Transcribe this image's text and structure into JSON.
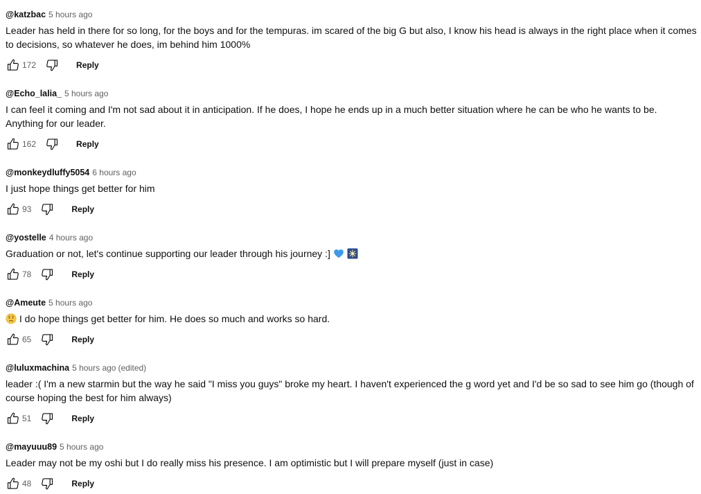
{
  "comments": [
    {
      "author": "@katzbac",
      "time": "5 hours ago",
      "text": "Leader has held in there for so long, for the boys and for the tempuras. im scared of the big G but also, I know his head is always in the right place when it comes to decisions, so whatever he does, im behind him 1000%",
      "likes": "172",
      "reply_label": "Reply"
    },
    {
      "author": "@Echo_lalia_",
      "time": "5 hours ago",
      "text": "I can feel it coming and I'm not sad about it in anticipation. If he does, I hope he ends up in a much better situation where he can be who he wants to be. Anything for our leader.",
      "likes": "162",
      "reply_label": "Reply"
    },
    {
      "author": "@monkeydluffy5054",
      "time": "6 hours ago",
      "text": "I just hope things get better for him",
      "likes": "93",
      "reply_label": "Reply"
    },
    {
      "author": "@yostelle",
      "time": "4 hours ago",
      "text": "Graduation or not, let's continue supporting our leader through his journey :]",
      "trailing_emojis": [
        "blue-heart-emoji",
        "sparkler-emoji"
      ],
      "likes": "78",
      "reply_label": "Reply"
    },
    {
      "author": "@Ameute",
      "time": "5 hours ago",
      "leading_emoji": "worried-face-emoji",
      "text": "I do hope things get better for him. He does so much and works so hard.",
      "likes": "65",
      "reply_label": "Reply"
    },
    {
      "author": "@luluxmachina",
      "time": "5 hours ago",
      "edited": "(edited)",
      "text": "leader :( I'm a new starmin but the way he said \"I miss you guys\" broke my heart. I haven't experienced the g word yet and I'd be so sad to see him go (though of course hoping the best for him always)",
      "likes": "51",
      "reply_label": "Reply"
    },
    {
      "author": "@mayuuu89",
      "time": "5 hours ago",
      "text": "Leader may not be my oshi but I do really miss his presence. I am optimistic but I will prepare myself (just in case)",
      "likes": "48",
      "reply_label": "Reply"
    }
  ],
  "colors": {
    "text": "#0f0f0f",
    "secondary": "#606060",
    "background": "#ffffff"
  }
}
